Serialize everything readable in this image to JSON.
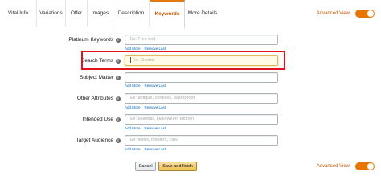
{
  "tabs": [
    {
      "label": "Vital Info"
    },
    {
      "label": "Variations"
    },
    {
      "label": "Offer"
    },
    {
      "label": "Images"
    },
    {
      "label": "Description"
    },
    {
      "label": "Keywords"
    },
    {
      "label": "More Details"
    }
  ],
  "active_tab": "Keywords",
  "advanced_view": {
    "label": "Advanced View",
    "state": "on"
  },
  "fields": [
    {
      "label": "Platinum Keywords",
      "placeholder": "Ex: Free text"
    },
    {
      "label": "Search Terms",
      "placeholder": "Ex: Electric"
    },
    {
      "label": "Subject Matter",
      "placeholder": ""
    },
    {
      "label": "Other Attributes",
      "placeholder": "Ex: antique, cordless, waterproof"
    },
    {
      "label": "Intended Use",
      "placeholder": "Ex: baseball, Halloween, kitchen"
    },
    {
      "label": "Target Audience",
      "placeholder": "Ex: teens, toddlers, cats"
    }
  ],
  "links": {
    "add_more": "Add More",
    "remove_last": "Remove Last"
  },
  "info_glyph": "i",
  "buttons": {
    "cancel": "Cancel",
    "save": "Save and finish"
  },
  "colors": {
    "accent": "#e47911",
    "highlight_box": "#e1141e",
    "save_button": "#f0c14b",
    "link": "#0066c0"
  }
}
